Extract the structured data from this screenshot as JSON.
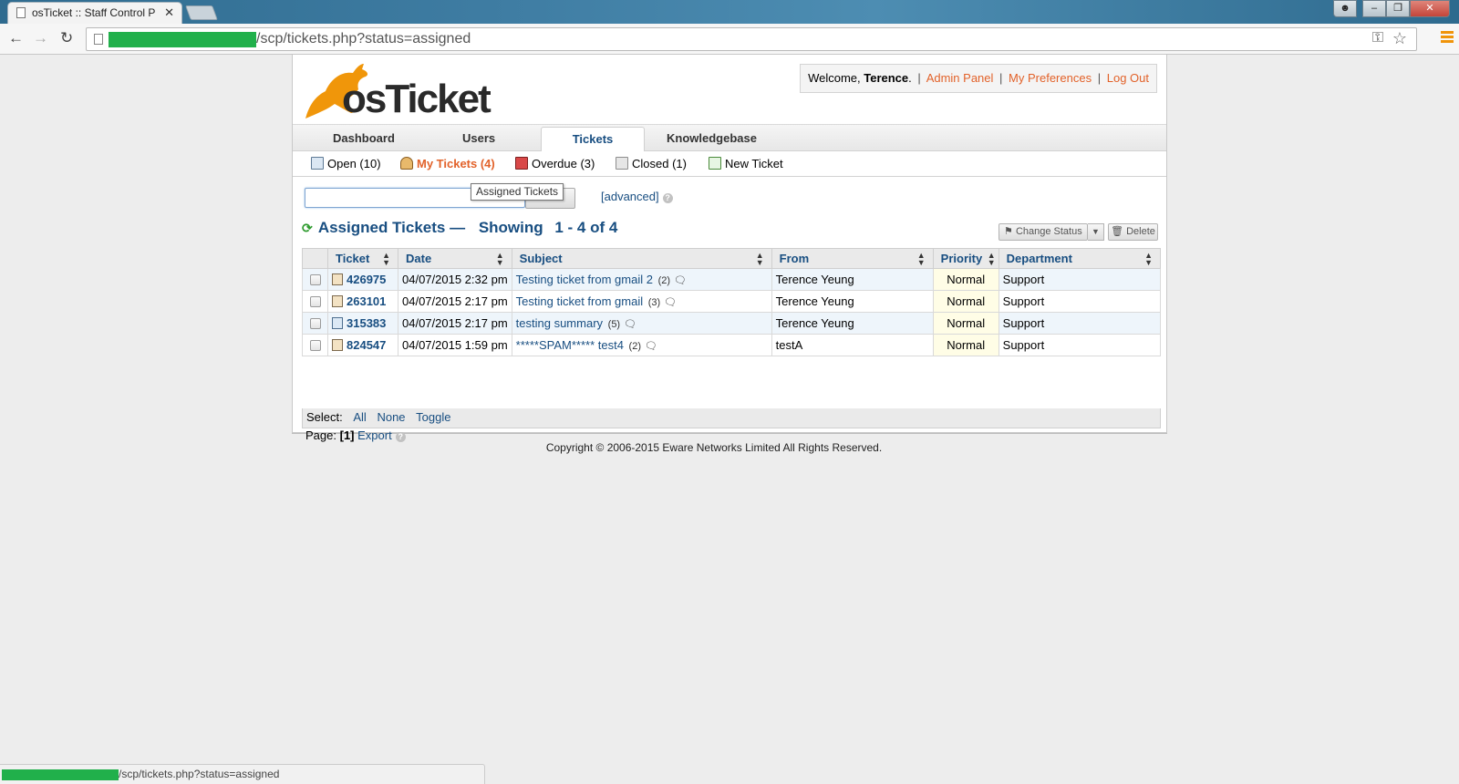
{
  "browser": {
    "tab_title": "osTicket :: Staff Control P",
    "tab_close": "✕",
    "url_path": "/scp/tickets.php?status=assigned",
    "status_url": "/scp/tickets.php?status=assigned"
  },
  "header": {
    "logo_text": "osTicket",
    "welcome_prefix": "Welcome, ",
    "user_name": "Terence",
    "welcome_suffix": ".",
    "links": [
      "Admin Panel",
      "My Preferences",
      "Log Out"
    ]
  },
  "main_nav": [
    "Dashboard",
    "Users",
    "Tickets",
    "Knowledgebase"
  ],
  "sub_nav": [
    {
      "label": "Open (10)"
    },
    {
      "label": "My Tickets (4)"
    },
    {
      "label": "Overdue (3)"
    },
    {
      "label": "Closed (1)"
    },
    {
      "label": "New Ticket"
    }
  ],
  "search": {
    "value": "",
    "tooltip": "Assigned Tickets",
    "advanced_label": "[advanced]"
  },
  "list": {
    "title": "Assigned Tickets —",
    "showing_label": "Showing",
    "range": "1 - 4 of 4",
    "change_status_label": "Change Status",
    "delete_label": "Delete"
  },
  "table": {
    "headers": [
      "Ticket",
      "Date",
      "Subject",
      "From",
      "Priority",
      "Department"
    ],
    "rows": [
      {
        "ticket": "426975",
        "date": "04/07/2015 2:32 pm",
        "subject": "Testing ticket from gmail 2",
        "count": "(2)",
        "from": "Terence Yeung",
        "priority": "Normal",
        "department": "Support"
      },
      {
        "ticket": "263101",
        "date": "04/07/2015 2:17 pm",
        "subject": "Testing ticket from gmail",
        "count": "(3)",
        "from": "Terence Yeung",
        "priority": "Normal",
        "department": "Support"
      },
      {
        "ticket": "315383",
        "date": "04/07/2015 2:17 pm",
        "subject": "testing summary",
        "count": "(5)",
        "from": "Terence Yeung",
        "priority": "Normal",
        "department": "Support"
      },
      {
        "ticket": "824547",
        "date": "04/07/2015 1:59 pm",
        "subject": "*****SPAM***** test4",
        "count": "(2)",
        "from": "testA",
        "priority": "Normal",
        "department": "Support"
      }
    ]
  },
  "select_row": {
    "label": "Select:",
    "options": [
      "All",
      "None",
      "Toggle"
    ]
  },
  "pager": {
    "label": "Page:",
    "current": "[1]",
    "export_label": "Export"
  },
  "footer": {
    "copyright": "Copyright © 2006-2015 Eware Networks Limited All Rights Reserved."
  },
  "colors": {
    "link_blue": "#184e81",
    "accent_orange": "#e2622a",
    "redaction_green": "#21b04b"
  }
}
